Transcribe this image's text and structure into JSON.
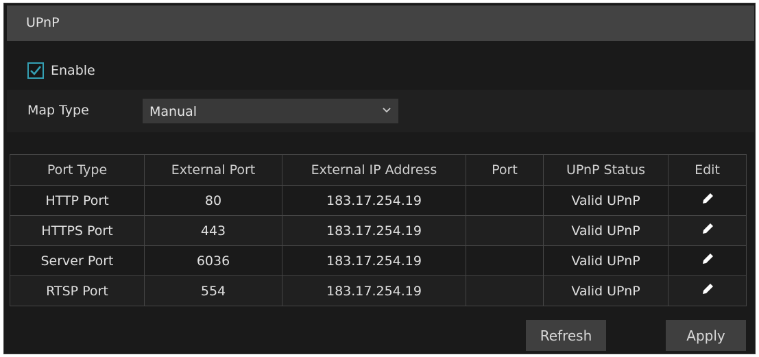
{
  "panel": {
    "title": "UPnP"
  },
  "enable": {
    "label": "Enable",
    "checked": true
  },
  "map_type": {
    "label": "Map Type",
    "value": "Manual"
  },
  "table": {
    "headers": [
      "Port Type",
      "External Port",
      "External IP Address",
      "Port",
      "UPnP Status",
      "Edit"
    ],
    "rows": [
      {
        "port_type": "HTTP Port",
        "external_port": "80",
        "external_ip": "183.17.254.19",
        "port": "",
        "status": "Valid UPnP",
        "edit_icon": "pencil-icon"
      },
      {
        "port_type": "HTTPS Port",
        "external_port": "443",
        "external_ip": "183.17.254.19",
        "port": "",
        "status": "Valid UPnP",
        "edit_icon": "pencil-icon"
      },
      {
        "port_type": "Server Port",
        "external_port": "6036",
        "external_ip": "183.17.254.19",
        "port": "",
        "status": "Valid UPnP",
        "edit_icon": "pencil-icon"
      },
      {
        "port_type": "RTSP Port",
        "external_port": "554",
        "external_ip": "183.17.254.19",
        "port": "",
        "status": "Valid UPnP",
        "edit_icon": "pencil-icon"
      }
    ]
  },
  "buttons": {
    "refresh": "Refresh",
    "apply": "Apply"
  },
  "colors": {
    "accent": "#34a0b4",
    "background": "#1a1a1a",
    "title_bar": "#434343"
  }
}
